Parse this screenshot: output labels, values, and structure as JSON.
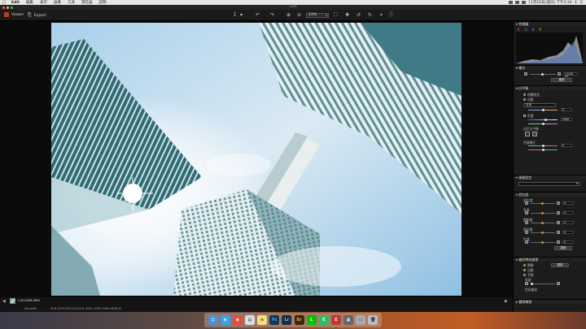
{
  "menubar": {
    "items": [
      "Edit",
      "編集",
      "表示",
      "画像",
      "工具",
      "現在画",
      "説明"
    ],
    "clock": "11月16日(週日) 下午3:34",
    "search_icon": "search-icon"
  },
  "window": {
    "title": "Edit"
  },
  "toolbar": {
    "viewer_label": "Viewer",
    "export_label": "Export",
    "zoom_value": "23%"
  },
  "panel": {
    "histogram_header": "色階圖",
    "histogram_channels": [
      "R",
      "G",
      "B",
      "Y"
    ],
    "tone_header": "曝光",
    "tone_value": "+0.00 EV",
    "reset_btn": "重設",
    "wb_header": "白平衡",
    "wb_options": [
      "相機設定",
      "自動"
    ],
    "wb_preset": "日光",
    "wb_temp_label": "色溫",
    "wb_temp_value": "5500",
    "wb_custom": "自訂白平衡",
    "wb_tint_label": "色調補正",
    "style_header": "風格設定",
    "dro_header": "對比度",
    "dro_rows": [
      "對比度",
      "亮度",
      "飽和度",
      "銳利度",
      "色溫"
    ],
    "dro_btn": "重設",
    "nr_header": "雜訊降低處理",
    "nr_options": [
      "關閉",
      "自動",
      "手動"
    ],
    "nr_btn": "重設",
    "nr_sub_label": "亮度",
    "nr_sub_label2": "色彩雜訊",
    "lens_header": "鏡頭補償"
  },
  "filmstrip": {
    "filename": "L1020286.ARW",
    "count_label": "Sonar0R",
    "meta": "f5.6  1/250  ISO100  f/2.8  100%  100%  RGB  sRGB  ID"
  },
  "dock": {
    "apps": [
      "Finder",
      "Safari",
      "Chrome",
      "Preview",
      "Notes",
      "Photoshop",
      "Lightroom",
      "Bridge",
      "LINE",
      "Evernote",
      "Edit",
      "Capture",
      "Finder2",
      "Trash"
    ]
  },
  "colors": {
    "accent": "#d88a2f",
    "panel_bg": "#1c1c1c",
    "sky": "#cfe4f2"
  }
}
